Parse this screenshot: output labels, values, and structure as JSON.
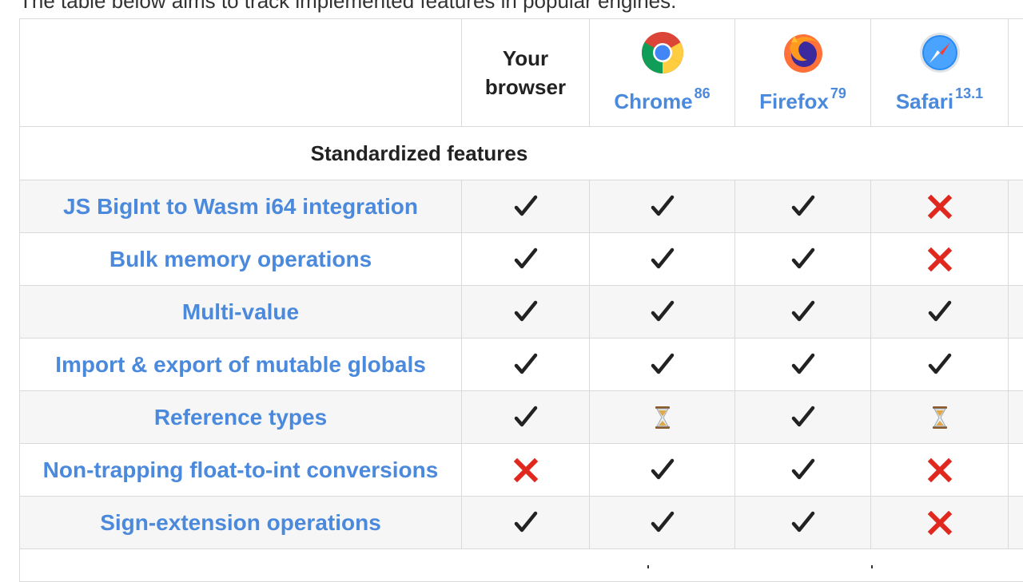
{
  "intro_text": "The table below aims to track implemented features in popular engines.",
  "columns": [
    {
      "label": "Your browser",
      "version": "",
      "icon": "none"
    },
    {
      "label": "Chrome",
      "version": "86",
      "icon": "chrome-icon"
    },
    {
      "label": "Firefox",
      "version": "79",
      "icon": "firefox-icon"
    },
    {
      "label": "Safari",
      "version": "13.1",
      "icon": "safari-icon"
    }
  ],
  "section_title": "Standardized features",
  "features": [
    {
      "name": "JS BigInt to Wasm i64 integration",
      "support": [
        "yes",
        "yes",
        "yes",
        "no"
      ]
    },
    {
      "name": "Bulk memory operations",
      "support": [
        "yes",
        "yes",
        "yes",
        "no"
      ]
    },
    {
      "name": "Multi-value",
      "support": [
        "yes",
        "yes",
        "yes",
        "yes"
      ]
    },
    {
      "name": "Import & export of mutable globals",
      "support": [
        "yes",
        "yes",
        "yes",
        "yes"
      ]
    },
    {
      "name": "Reference types",
      "support": [
        "yes",
        "in-progress",
        "yes",
        "in-progress"
      ]
    },
    {
      "name": "Non-trapping float-to-int conversions",
      "support": [
        "no",
        "yes",
        "yes",
        "no"
      ]
    },
    {
      "name": "Sign-extension operations",
      "support": [
        "yes",
        "yes",
        "yes",
        "no"
      ]
    }
  ],
  "colors": {
    "link": "#4a89dc",
    "no": "#e0281f",
    "yes": "#222222",
    "border": "#dadada",
    "stripe": "#f6f6f6"
  }
}
